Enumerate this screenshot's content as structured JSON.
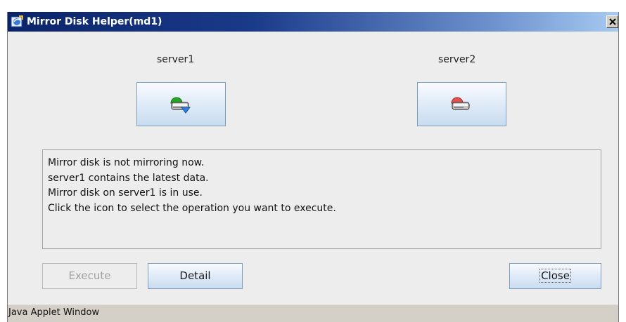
{
  "window": {
    "title": "Mirror Disk Helper(md1)",
    "close_glyph": "X"
  },
  "servers": [
    {
      "label": "server1",
      "icon": "mirror-disk-active-icon",
      "status_color": "#22aa22"
    },
    {
      "label": "server2",
      "icon": "mirror-disk-error-icon",
      "status_color": "#e8504a"
    }
  ],
  "message": {
    "lines": [
      "Mirror disk is not mirroring now.",
      "server1 contains the latest data.",
      "Mirror disk on server1 is in use.",
      "Click the icon to select the operation you want to execute."
    ]
  },
  "buttons": {
    "execute": "Execute",
    "detail": "Detail",
    "close": "Close"
  },
  "status_bar": {
    "text": "Java Applet Window"
  },
  "colors": {
    "title_bar_start": "#0a246a",
    "title_bar_end": "#a6caf0",
    "button_border": "#7f9db9"
  }
}
